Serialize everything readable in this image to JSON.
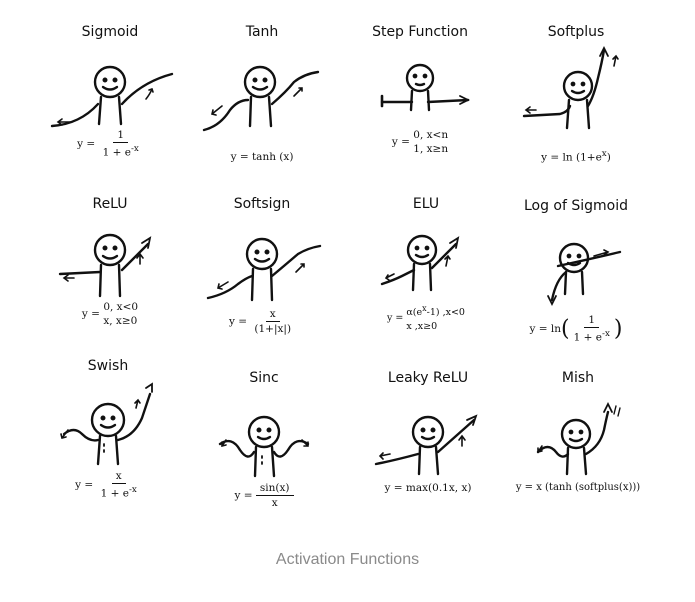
{
  "caption": "Activation Functions",
  "panels": [
    {
      "name": "Sigmoid",
      "formula": {
        "lhs": "y =",
        "num": "1",
        "den": "1 + e",
        "den_sup": "-x"
      }
    },
    {
      "name": "Tanh",
      "formula": {
        "text": "y = tanh (x)"
      }
    },
    {
      "name": "Step Function",
      "formula": {
        "lhs": "y =",
        "case1": "0,  x<n",
        "case2": "1,  x≥n"
      }
    },
    {
      "name": "Softplus",
      "formula": {
        "text": "y = ln (1+e",
        "sup": "x",
        "tail": ")"
      }
    },
    {
      "name": "ReLU",
      "formula": {
        "lhs": "y =",
        "case1": "0,  x<0",
        "case2": "x,  x≥0"
      }
    },
    {
      "name": "Softsign",
      "formula": {
        "lhs": "y =",
        "num": "x",
        "den": "(1+|x|)"
      }
    },
    {
      "name": "ELU",
      "formula": {
        "lhs": "y =",
        "case1": "α(e",
        "case1_sup": "x",
        "case1_tail": "-1) ,x<0",
        "case2": "x          ,x≥0"
      }
    },
    {
      "name": "Log of Sigmoid",
      "formula": {
        "lhs": "y = ln",
        "num": "1",
        "den": "1 + e",
        "den_sup": "-x"
      }
    },
    {
      "name": "Swish",
      "formula": {
        "lhs": "y =",
        "num": "x",
        "den": "1 + e",
        "den_sup": "-x"
      }
    },
    {
      "name": "Sinc",
      "formula": {
        "lhs": "y =",
        "num": "sin(x)",
        "den": "x"
      }
    },
    {
      "name": "Leaky ReLU",
      "formula": {
        "text": "y = max(0.1x, x)"
      }
    },
    {
      "name": "Mish",
      "formula": {
        "text": "y = x (tanh (softplus(x)))"
      }
    }
  ]
}
